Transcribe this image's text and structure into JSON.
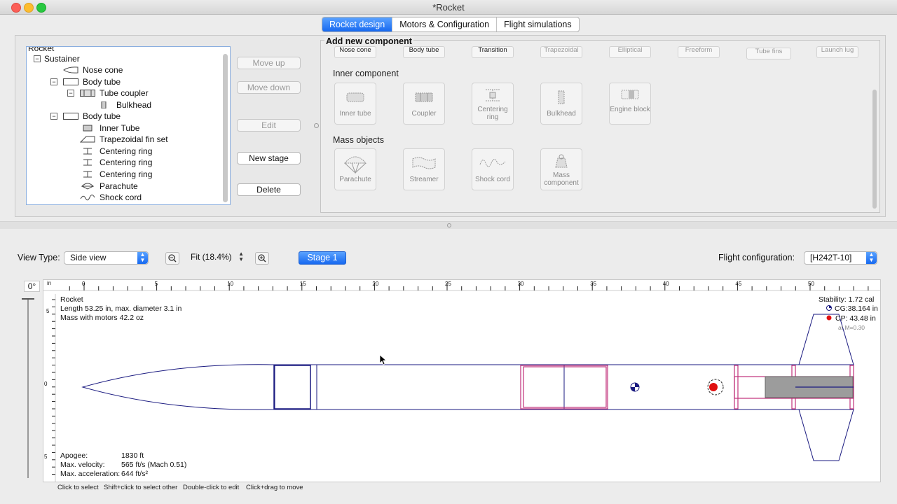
{
  "window": {
    "title": "*Rocket"
  },
  "tabs": [
    "Rocket design",
    "Motors & Configuration",
    "Flight simulations"
  ],
  "tree": {
    "root": "Rocket",
    "items": [
      {
        "label": "Sustainer",
        "icon": "stage-icon"
      },
      {
        "label": "Nose cone",
        "icon": "nose-cone-icon"
      },
      {
        "label": "Body tube",
        "icon": "body-tube-icon"
      },
      {
        "label": "Tube coupler",
        "icon": "tube-coupler-icon"
      },
      {
        "label": "Bulkhead",
        "icon": "bulkhead-icon"
      },
      {
        "label": "Body tube",
        "icon": "body-tube-icon"
      },
      {
        "label": "Inner Tube",
        "icon": "inner-tube-icon"
      },
      {
        "label": "Trapezoidal fin set",
        "icon": "fin-set-icon"
      },
      {
        "label": "Centering ring",
        "icon": "centering-ring-icon"
      },
      {
        "label": "Centering ring",
        "icon": "centering-ring-icon"
      },
      {
        "label": "Centering ring",
        "icon": "centering-ring-icon"
      },
      {
        "label": "Parachute",
        "icon": "parachute-icon"
      },
      {
        "label": "Shock cord",
        "icon": "shock-cord-icon"
      }
    ]
  },
  "actions": {
    "move_up": "Move up",
    "move_down": "Move down",
    "edit": "Edit",
    "new_stage": "New stage",
    "delete": "Delete"
  },
  "add_component": {
    "title": "Add new component",
    "top_row": [
      "Nose cone",
      "Body tube",
      "Transition",
      "Trapezoidal",
      "Elliptical",
      "Freeform",
      "Tube fins",
      "Launch lug"
    ],
    "inner_title": "Inner component",
    "inner": [
      "Inner tube",
      "Coupler",
      "Centering ring",
      "Bulkhead",
      "Engine block"
    ],
    "mass_title": "Mass objects",
    "mass": [
      "Parachute",
      "Streamer",
      "Shock cord",
      "Mass component"
    ]
  },
  "view": {
    "type_label": "View Type:",
    "type_value": "Side view",
    "zoom_value": "Fit (18.4%)",
    "stage_button": "Stage 1",
    "flight_config_label": "Flight configuration:",
    "flight_config_value": "[H242T-10]",
    "rotation": "0°"
  },
  "ruler": {
    "unit": "in",
    "ticks": [
      "0",
      "5",
      "10",
      "15",
      "20",
      "25",
      "30",
      "35",
      "40",
      "45",
      "50",
      "5"
    ]
  },
  "rocket_info": {
    "name": "Rocket",
    "length": "Length 53.25 in, max. diameter 3.1 in",
    "mass": "Mass with motors 42.2 oz",
    "stability": "Stability:  1.72 cal",
    "cg": "CG:38.164 in",
    "cp": "CP: 43.48 in",
    "mach": "at M=0.30"
  },
  "flight": {
    "apogee_label": "Apogee:",
    "apogee": "1830 ft",
    "velocity_label": "Max. velocity:",
    "velocity": "565 ft/s  (Mach 0.51)",
    "accel_label": "Max. acceleration:",
    "accel": "644 ft/s²"
  },
  "vertical_ruler": {
    "top": "5",
    "middle": "0",
    "bottom": "5"
  },
  "hints": [
    "Click to select",
    "Shift+click to select other",
    "Double-click to edit",
    "Click+drag to move"
  ],
  "colors": {
    "accent": "#1769f0",
    "outline": "#1a1a80",
    "inner": "#c0307a",
    "cp": "#e01010"
  }
}
